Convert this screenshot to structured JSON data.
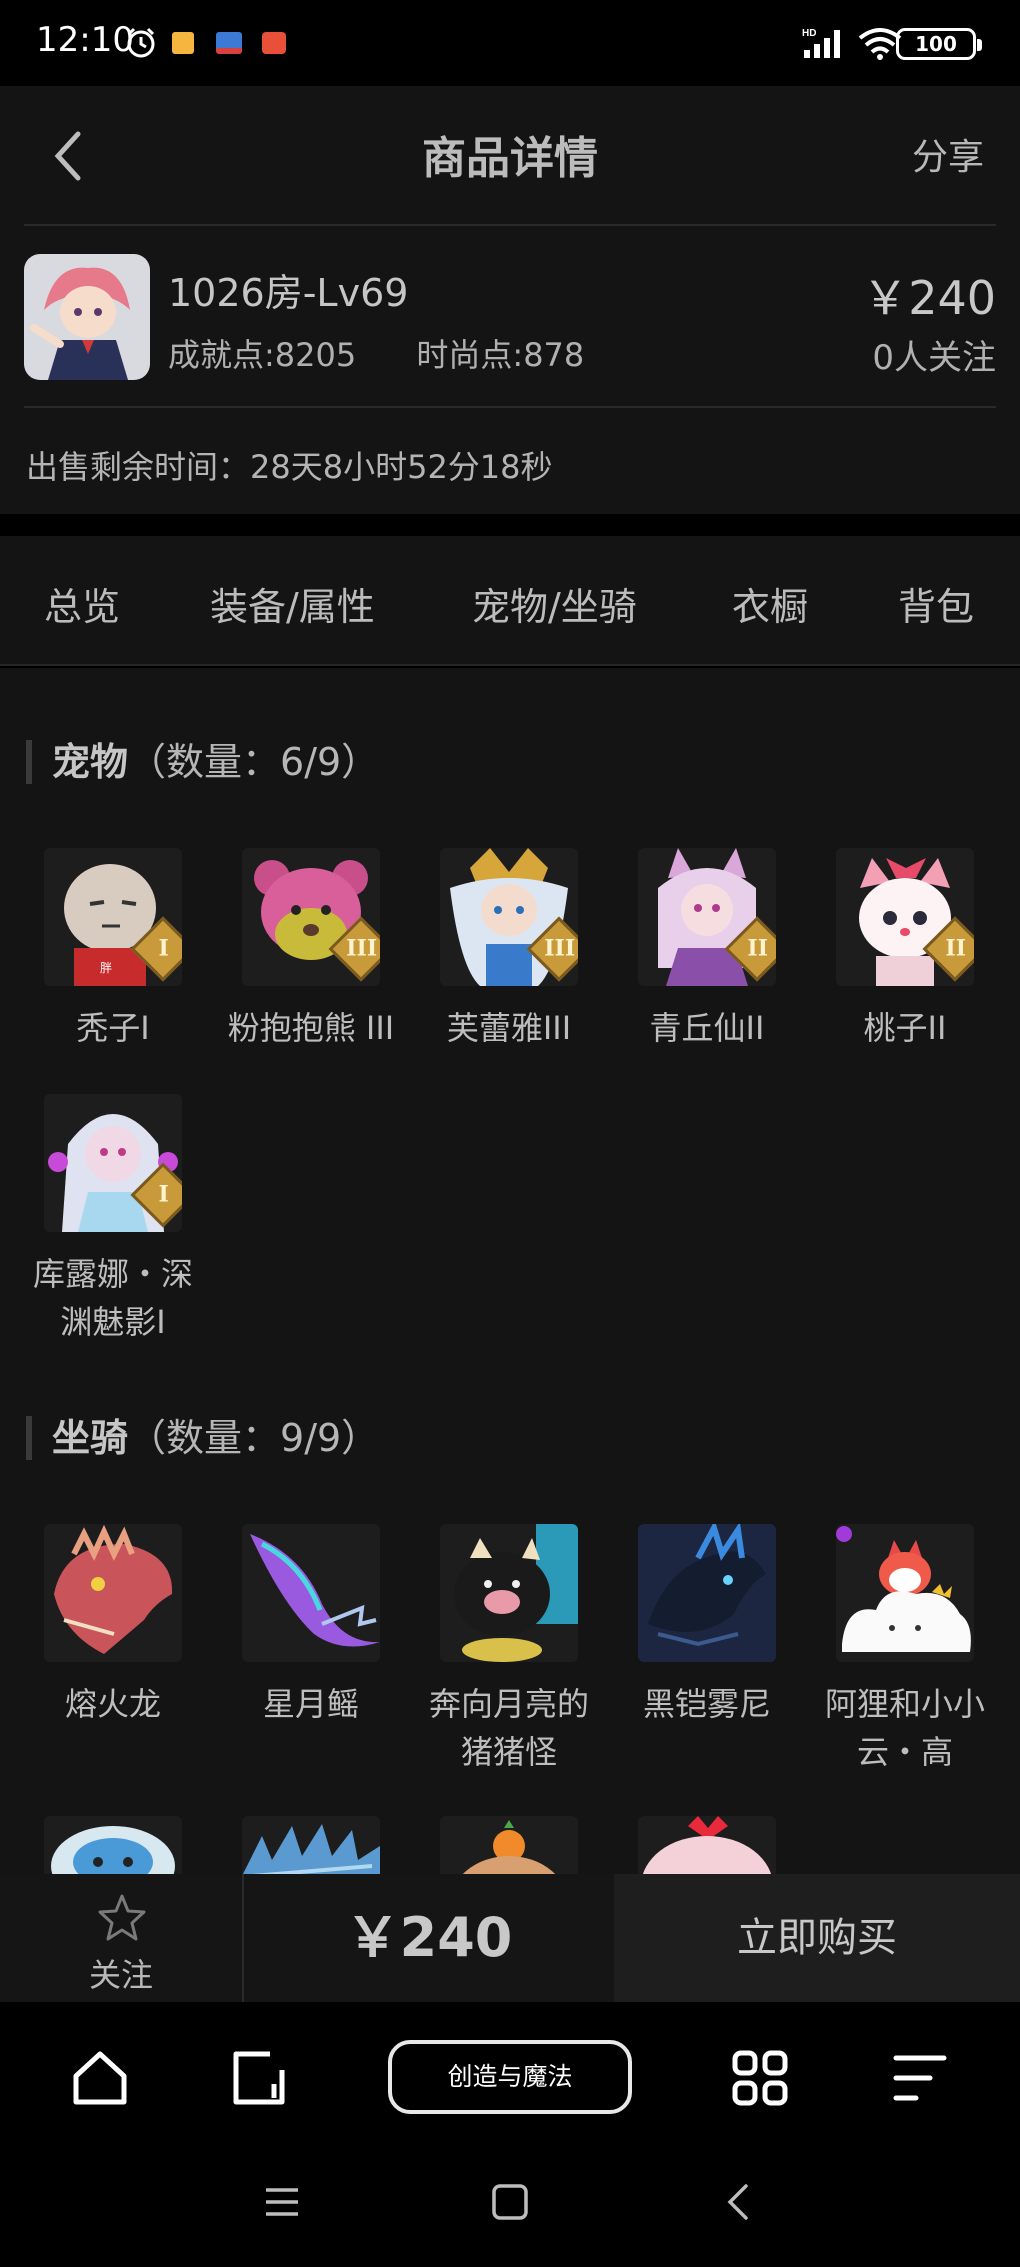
{
  "status_bar": {
    "time": "12:10",
    "battery": "100"
  },
  "header": {
    "title": "商品详情",
    "share": "分享"
  },
  "product": {
    "room": "1026房-Lv69",
    "achievement": "成就点:8205",
    "fashion": "时尚点:878",
    "price": "￥240",
    "followers": "0人关注",
    "remaining": "出售剩余时间：28天8小时52分18秒"
  },
  "tabs": [
    {
      "label": "总览"
    },
    {
      "label": "装备/属性"
    },
    {
      "label": "宠物/坐骑"
    },
    {
      "label": "衣橱"
    },
    {
      "label": "背包"
    }
  ],
  "pets": {
    "title": "宠物",
    "count": "（数量：6/9）",
    "items": [
      {
        "name": "秃子I",
        "tier": "I"
      },
      {
        "name": "粉抱抱熊 III",
        "tier": "III"
      },
      {
        "name": "芙蕾雅III",
        "tier": "III"
      },
      {
        "name": "青丘仙II",
        "tier": "II"
      },
      {
        "name": "桃子II",
        "tier": "II"
      },
      {
        "name": "库露娜・深渊魅影I",
        "name_line1": "库露娜・深",
        "name_line2": "渊魅影I",
        "tier": "I"
      }
    ]
  },
  "mounts": {
    "title": "坐骑",
    "count": "（数量：9/9）",
    "items": [
      {
        "name": "熔火龙"
      },
      {
        "name": "星月鳐"
      },
      {
        "name": "奔向月亮的猪猪怪",
        "name_line1": "奔向月亮的",
        "name_line2": "猪猪怪"
      },
      {
        "name": "黑铠雾尼"
      },
      {
        "name": "阿狸和小小云・高",
        "name_line1": "阿狸和小小",
        "name_line2": "云・高"
      }
    ]
  },
  "buy_bar": {
    "follow_label": "关注",
    "price": "￥240",
    "buy_label": "立即购买"
  },
  "bottom_nav": {
    "create_label": "创造与魔法"
  }
}
